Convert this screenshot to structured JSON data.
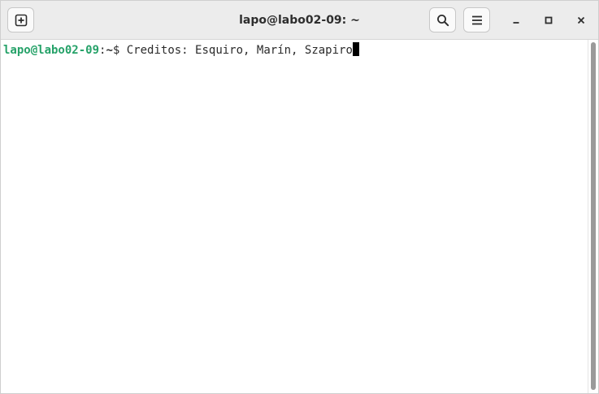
{
  "window": {
    "title": "lapo@labo02-09: ~"
  },
  "header": {
    "new_tab_icon": "new-tab-plus-icon",
    "search_icon": "search-icon",
    "menu_icon": "hamburger-menu-icon",
    "minimize_icon": "minimize-icon",
    "maximize_icon": "maximize-icon",
    "close_icon": "close-icon"
  },
  "terminal": {
    "prompt_user_host": "lapo@labo02-09",
    "prompt_colon": ":",
    "prompt_path": "~",
    "prompt_symbol": "$ ",
    "command": "Creditos: Esquiro, Marín, Szapiro"
  },
  "colors": {
    "prompt_user": "#26a269",
    "header_bg": "#ececec",
    "background": "#ffffff",
    "scrollbar_thumb": "#9a9a9a"
  }
}
